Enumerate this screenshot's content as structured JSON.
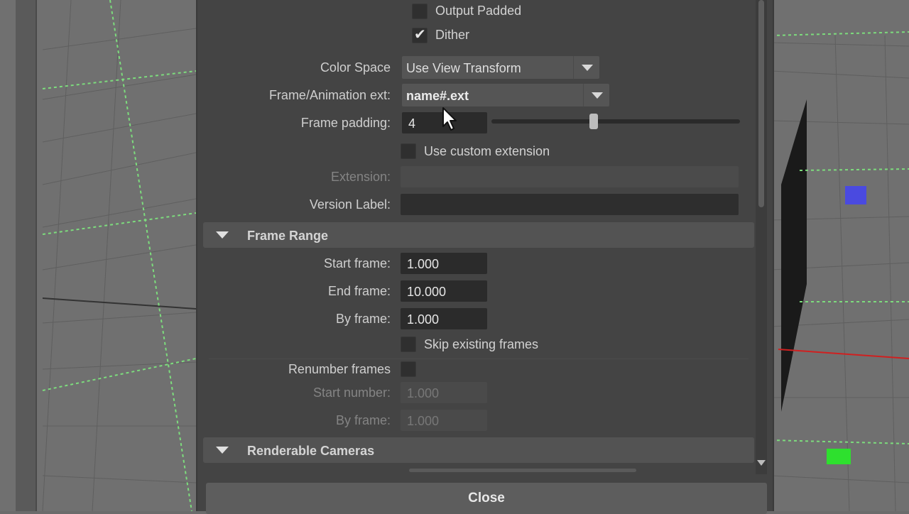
{
  "dialog": {
    "output_padded_label": "Output Padded",
    "output_padded_checked": false,
    "dither_label": "Dither",
    "dither_checked": true,
    "color_space": {
      "label": "Color Space",
      "value": "Use View Transform"
    },
    "frame_animation_ext": {
      "label": "Frame/Animation ext:",
      "value": "name#.ext"
    },
    "frame_padding": {
      "label": "Frame padding:",
      "value": "4",
      "slider_fraction": 0.41
    },
    "use_custom_extension": {
      "label": "Use custom extension",
      "checked": false
    },
    "extension": {
      "label": "Extension:",
      "value": ""
    },
    "version_label": {
      "label": "Version Label:",
      "value": ""
    },
    "frame_range": {
      "title": "Frame Range",
      "start_frame": {
        "label": "Start frame:",
        "value": "1.000"
      },
      "end_frame": {
        "label": "End frame:",
        "value": "10.000"
      },
      "by_frame": {
        "label": "By frame:",
        "value": "1.000"
      },
      "skip_existing": {
        "label": "Skip existing frames",
        "checked": false
      },
      "renumber_frames": {
        "label": "Renumber frames",
        "checked": false
      },
      "start_number": {
        "label": "Start number:",
        "value": "1.000"
      },
      "renumber_by_frame": {
        "label": "By frame:",
        "value": "1.000"
      }
    },
    "renderable_cameras": {
      "title": "Renderable Cameras"
    },
    "close_label": "Close"
  },
  "colors": {
    "dialog_bg": "#444444",
    "field_bg": "#2b2b2b",
    "grid_line": "#5a5a5a",
    "dashed_green": "#7ddc7d",
    "marker_blue": "#4a4ae0",
    "marker_green": "#2ee02e",
    "axis_red": "#d02020"
  },
  "icons": [
    "checkbox-icon",
    "check-mark-icon",
    "dropdown-arrow-icon",
    "section-collapse-icon",
    "scroll-down-icon",
    "mouse-pointer-icon"
  ]
}
